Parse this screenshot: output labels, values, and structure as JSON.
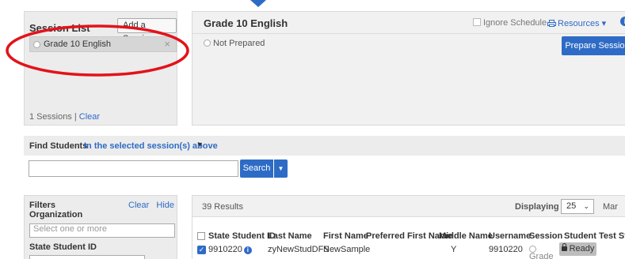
{
  "session_list": {
    "title": "Session List",
    "add_button": "Add a Session",
    "items": [
      {
        "label": "Grade 10 English",
        "remove_glyph": "×"
      }
    ],
    "footer_count": "1 Sessions |",
    "footer_clear": "Clear"
  },
  "session_detail": {
    "title": "Grade 10 English",
    "ignore_schedule": "Ignore Schedule",
    "resources": "Resources ▾",
    "info_glyph": "i",
    "status": "Not Prepared",
    "prepare_button": "Prepare Session"
  },
  "find_students": {
    "label": "Find Students",
    "scope": "In the selected session(s) above",
    "scope_caret": "▼",
    "search_value": "",
    "search_button": "Search",
    "search_dropdown_glyph": "▼"
  },
  "filters": {
    "title": "Filters",
    "clear": "Clear",
    "hide": "Hide",
    "organization_label": "Organization",
    "organization_placeholder": "Select one or more",
    "state_student_id_label": "State Student ID"
  },
  "results": {
    "count": "39 Results",
    "displaying_label": "Displaying",
    "per_page": "25",
    "per_page_chevron": "⌄",
    "manage": "Mar",
    "columns": [
      "State Student ID",
      "Last Name",
      "First Name",
      "Preferred First Name",
      "Middle Name",
      "Username",
      "Session",
      "Student Test Status"
    ],
    "rows": [
      {
        "checked_glyph": "✓",
        "state_student_id": "9910220",
        "last_name": "zyNewStudDFS",
        "first_name": "NewSample",
        "preferred_first_name": "",
        "middle_name": "Y",
        "username": "9910220",
        "session": "Grade",
        "status": "Ready"
      }
    ]
  },
  "colors": {
    "accent": "#2e6bc6",
    "panel_bg": "#ececec",
    "annotation_red": "#e3121b"
  },
  "icons": [
    "caret-down-icon",
    "close-icon",
    "printer-icon",
    "info-icon",
    "lock-icon",
    "chevron-down-icon"
  ]
}
